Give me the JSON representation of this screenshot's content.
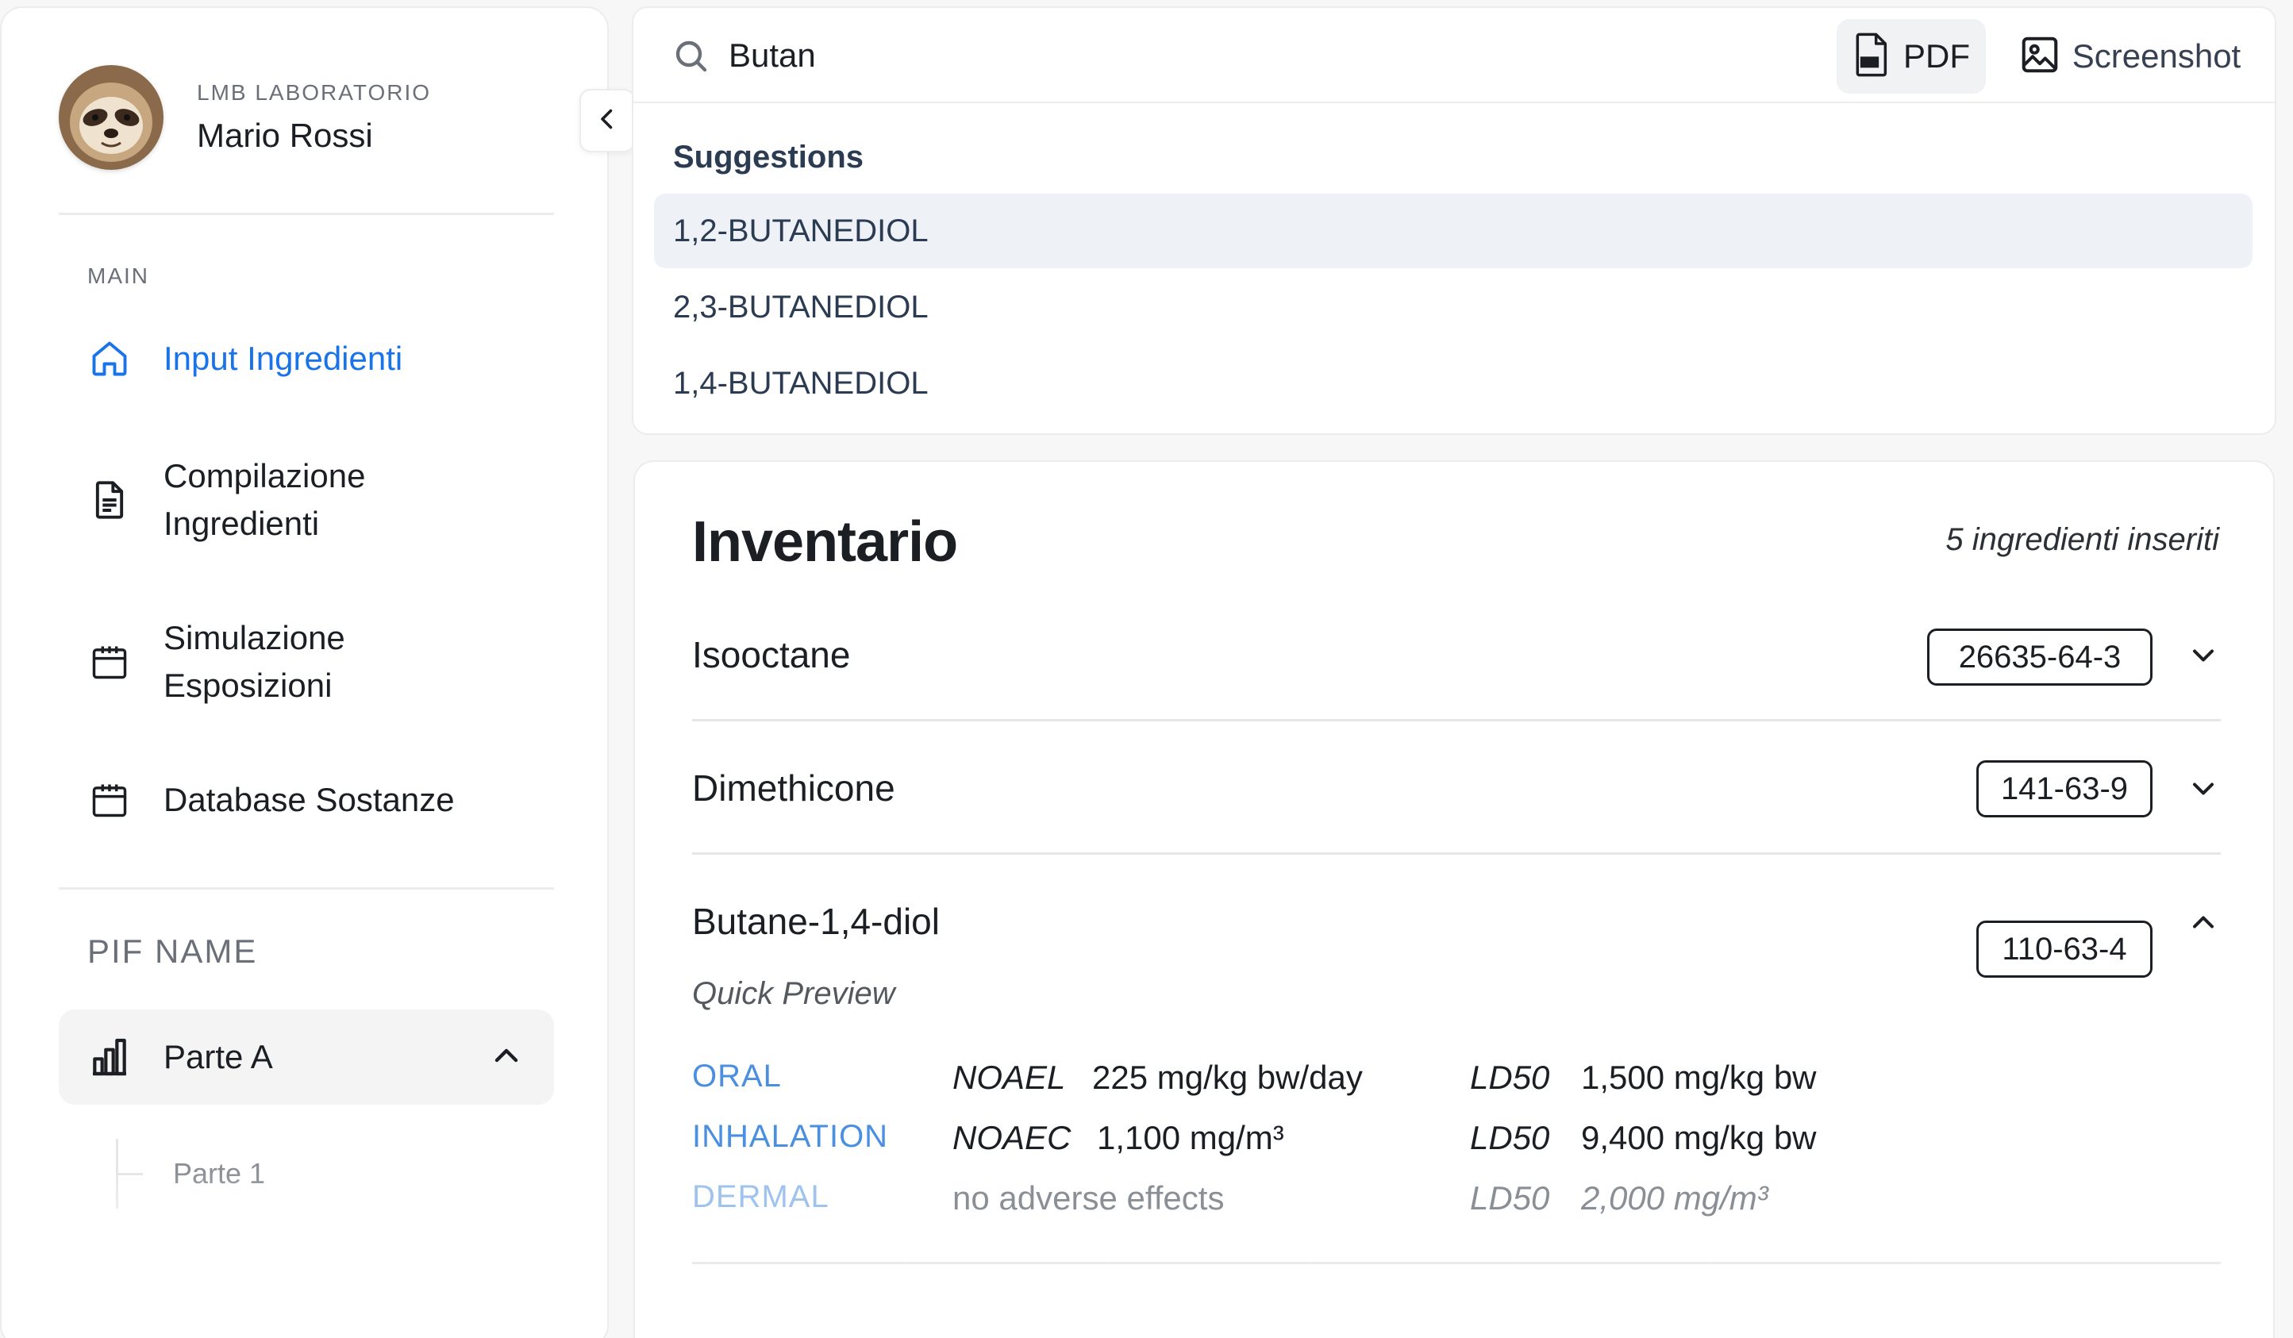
{
  "profile": {
    "org": "LMB LABORATORIO",
    "name": "Mario Rossi",
    "avatar_icon": "sloth-avatar"
  },
  "sidebar": {
    "section_main": "MAIN",
    "items": [
      {
        "label": "Input Ingredienti",
        "icon": "home-icon",
        "active": true
      },
      {
        "label": "Compilazione Ingredienti",
        "icon": "document-icon",
        "active": false
      },
      {
        "label": "Simulazione Esposizioni",
        "icon": "calendar-icon",
        "active": false
      },
      {
        "label": "Database Sostanze",
        "icon": "calendar-icon",
        "active": false
      }
    ],
    "section_pif": "PIF NAME",
    "group": {
      "label": "Parte A",
      "icon": "bar-chart-icon",
      "expanded": true
    },
    "sub_items": [
      "Parte 1"
    ]
  },
  "search": {
    "value": "Butan",
    "pdf_label": "PDF",
    "screenshot_label": "Screenshot",
    "suggestions_title": "Suggestions",
    "suggestions": [
      "1,2-BUTANEDIOL",
      "2,3-BUTANEDIOL",
      "1,4-BUTANEDIOL"
    ]
  },
  "inventory": {
    "title": "Inventario",
    "count_text": "5 ingredienti inseriti",
    "ingredients": [
      {
        "name": "Isooctane",
        "cas": "26635-64-3",
        "expanded": false
      },
      {
        "name": "Dimethicone",
        "cas": "141-63-9",
        "expanded": false
      },
      {
        "name": "Butane-1,4-diol",
        "cas": "110-63-4",
        "expanded": true
      }
    ],
    "preview": {
      "title": "Quick Preview",
      "rows": [
        {
          "route": "ORAL",
          "noael_key": "NOAEL",
          "noael_val": "225 mg/kg bw/day",
          "ld_key": "LD50",
          "ld_val": "1,500 mg/kg bw"
        },
        {
          "route": "INHALATION",
          "noael_key": "NOAEC",
          "noael_val": "1,100 mg/m³",
          "ld_key": "LD50",
          "ld_val": "9,400 mg/kg bw"
        },
        {
          "route": "DERMAL",
          "noael_key": "",
          "noael_val": "no adverse effects",
          "ld_key": "LD50",
          "ld_val": "2,000 mg/m³"
        }
      ]
    }
  },
  "colors": {
    "accent": "#1a73e8",
    "route": "#4a8fe0"
  }
}
